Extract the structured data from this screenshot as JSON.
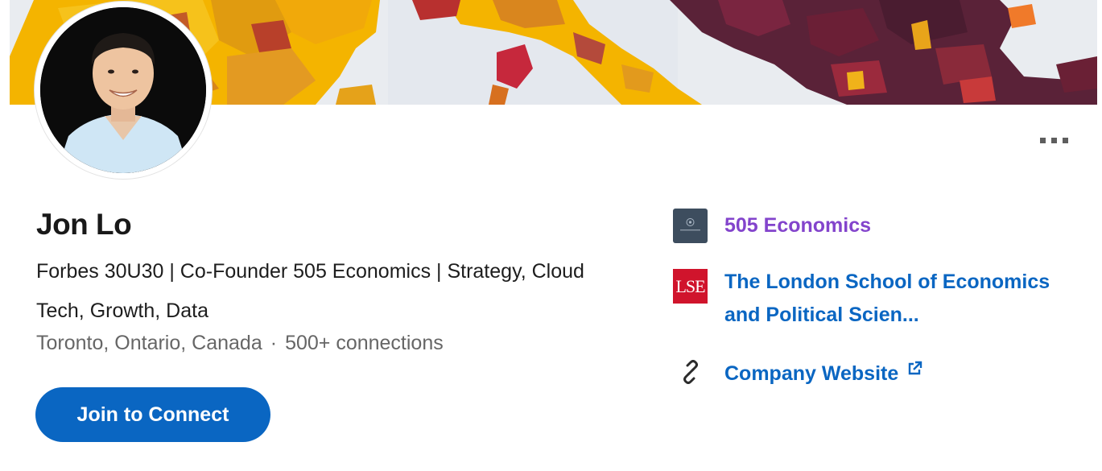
{
  "profile": {
    "name": "Jon Lo",
    "headline": "Forbes 30U30 | Co-Founder 505 Economics | Strategy, Cloud Tech, Growth, Data",
    "location": "Toronto, Ontario, Canada",
    "separator": "·",
    "connections": "500+ connections"
  },
  "actions": {
    "join_label": "Join to Connect",
    "more_icon": "more-horizontal-icon"
  },
  "sidebar": {
    "company": {
      "name": "505 Economics",
      "logo_text": "505 ECONOMICS",
      "color": "#8344cc"
    },
    "school": {
      "name": "The London School of Economics and Political Scien...",
      "logo_text": "LSE",
      "logo_color": "#d0142c"
    },
    "website": {
      "label": "Company Website",
      "icon": "link-icon",
      "external_icon": "external-link-icon"
    }
  },
  "colors": {
    "accent": "#0a66c2",
    "text": "#191919",
    "muted": "#666666"
  }
}
